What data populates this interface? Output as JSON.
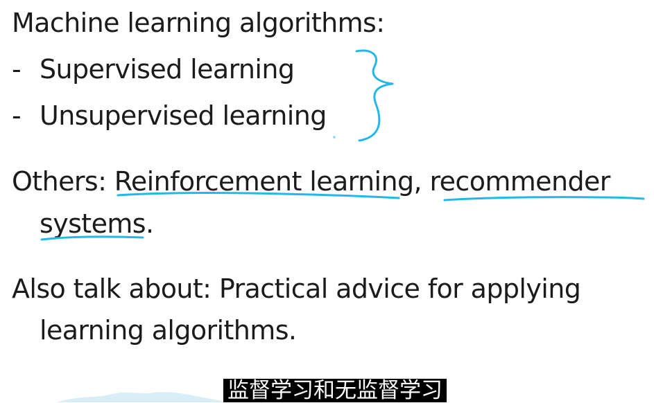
{
  "slide": {
    "title": "Machine learning algorithms:",
    "bullets": [
      "Supervised learning",
      "Unsupervised learning"
    ],
    "bullet_marker": "-",
    "others_prefix": "Others: ",
    "others_item1": "Reinforcement learning",
    "others_sep": ", ",
    "others_item2_part1": "recommender",
    "others_item2_part2": "systems",
    "others_end": ".",
    "also_line1": "Also talk about: Practical advice for applying",
    "also_line2": "learning algorithms."
  },
  "subtitle": {
    "text": "监督学习和无监督学习"
  },
  "colors": {
    "ink": "#21b7e9",
    "text": "#1b1b1b",
    "subtitle_bg": "#000000",
    "subtitle_text": "#ffffff"
  }
}
